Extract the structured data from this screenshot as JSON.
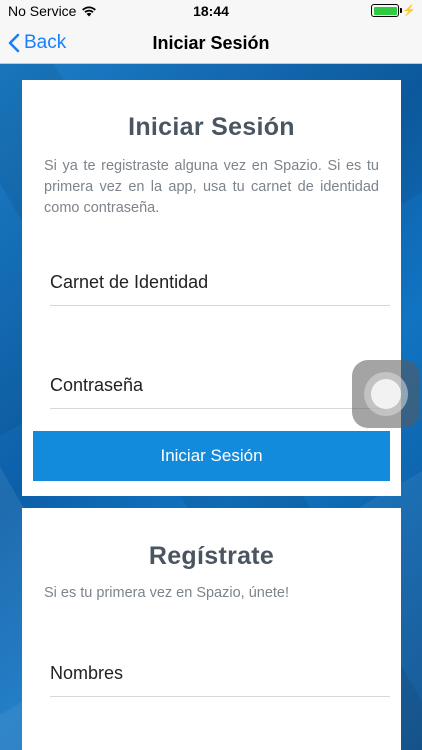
{
  "status_bar": {
    "carrier": "No Service",
    "time": "18:44",
    "icons": [
      "wifi-icon",
      "battery-icon",
      "bolt-icon"
    ]
  },
  "nav": {
    "back_label": "Back",
    "title": "Iniciar Sesión"
  },
  "login": {
    "title": "Iniciar Sesión",
    "description": "Si ya te registraste alguna vez en Spazio. Si es tu primera vez en la app, usa tu carnet de identidad como contraseña.",
    "id_placeholder": "Carnet de Identidad",
    "password_placeholder": "Contraseña",
    "submit_label": "Iniciar Sesión"
  },
  "register": {
    "title": "Regístrate",
    "description": "Si es tu primera vez en Spazio, únete!",
    "names_placeholder": "Nombres"
  },
  "colors": {
    "accent": "#138bdd",
    "back_link": "#1a7ffb",
    "title_text": "#4a5561",
    "background": "#0e67b5"
  }
}
